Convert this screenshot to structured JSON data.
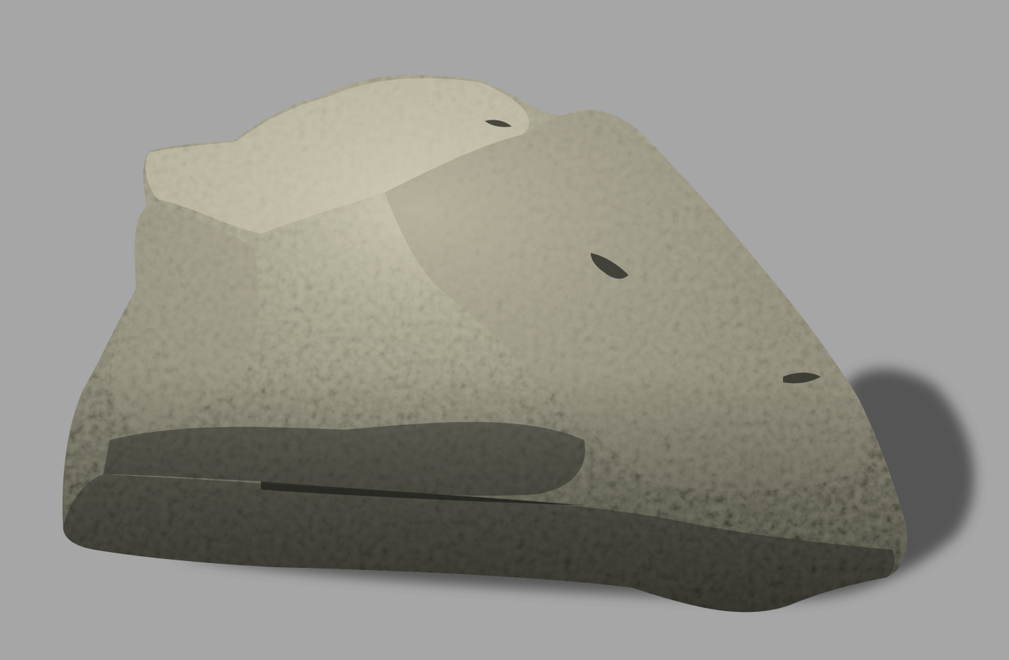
{
  "scene": {
    "subject": "rock-3d-render",
    "colors": {
      "background": "#a6a6a6",
      "shadow": "#474747",
      "rock_base": "#7e7c6e",
      "rock_light": "#cfcbb5",
      "rock_mid": "#9d9a88",
      "rock_dark": "#3f4038",
      "rock_crevice": "#2a2b26"
    }
  }
}
